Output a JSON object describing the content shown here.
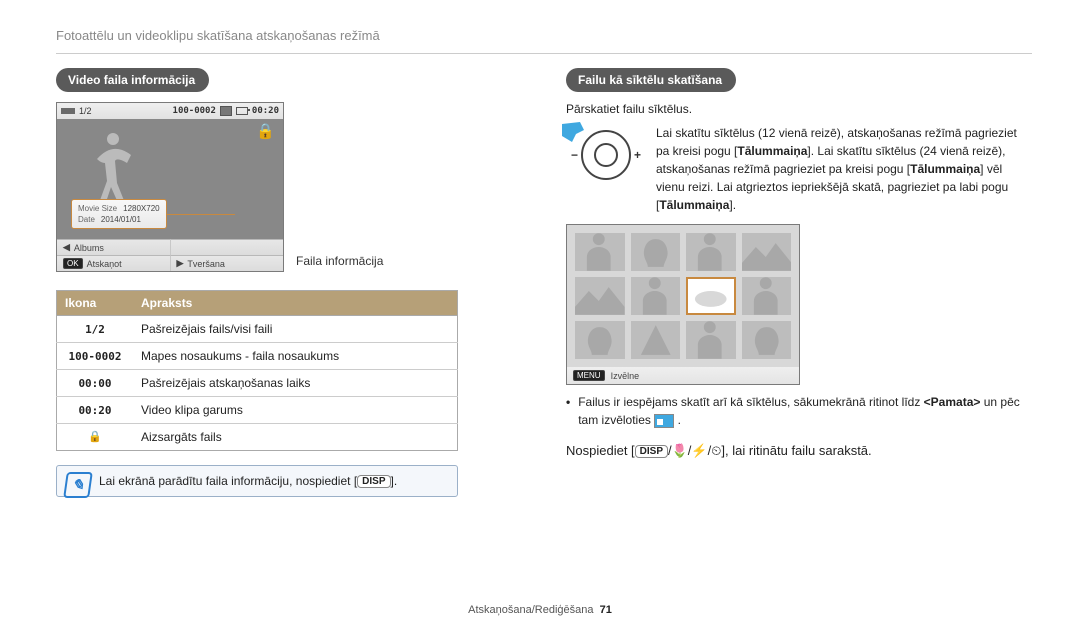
{
  "breadcrumb": "Fotoattēlu un videoklipu skatīšana atskaņošanas režīmā",
  "left": {
    "heading": "Video faila informācija",
    "camera": {
      "top_left_counter": "1/2",
      "top_folder": "100-0002",
      "top_time": "00:20",
      "lock_tooltip": "Aizsargāts",
      "popup_movie_size_k": "Movie Size",
      "popup_movie_size_v": "1280X720",
      "popup_date_k": "Date",
      "popup_date_v": "2014/01/01",
      "albums_arrow": "◀",
      "albums_label": "Albums",
      "ok_box": "OK",
      "ok_label": "Atskaņot",
      "capture_arrow": "▶",
      "capture_label": "Tveršana"
    },
    "callout": "Faila informācija",
    "table": {
      "h1": "Ikona",
      "h2": "Apraksts",
      "rows": [
        {
          "icon": "1/2",
          "desc": "Pašreizējais fails/visi faili"
        },
        {
          "icon": "100-0002",
          "desc": "Mapes nosaukums - faila nosaukums"
        },
        {
          "icon": "00:00",
          "desc": "Pašreizējais atskaņošanas laiks"
        },
        {
          "icon": "00:20",
          "desc": "Video klipa garums"
        },
        {
          "icon": "lock",
          "desc": "Aizsargāts fails"
        }
      ]
    },
    "note_pre": "Lai ekrānā parādītu faila informāciju, nospiediet [",
    "note_btn": "DISP",
    "note_post": "]."
  },
  "right": {
    "heading": "Failu kā sīktēlu skatīšana",
    "subtext": "Pārskatiet failu sīktēlus.",
    "zoom_text_pre": "Lai skatītu sīktēlus (12 vienā reizē), atskaņošanas režīmā pagrieziet pa kreisi pogu [",
    "zoom_b1": "Tālummaiņa",
    "zoom_mid": "]. Lai skatītu sīktēlus (24 vienā reizē), atskaņošanas režīmā pagrieziet pa kreisi pogu [",
    "zoom_b2": "Tālummaiņa",
    "zoom_mid2": "] vēl vienu reizi. Lai atgrieztos iepriekšējā skatā, pagrieziet pa labi pogu [",
    "zoom_b3": "Tālummaiņa",
    "zoom_end": "].",
    "thumb_bottom_menu": "MENU",
    "thumb_bottom_label": "Izvēlne",
    "bullet_pre": "Failus ir iespējams skatīt arī kā sīktēlus, sākumekrānā ritinot līdz ",
    "bullet_bold": "<Pamata>",
    "bullet_mid": " un pēc tam izvēloties ",
    "bullet_post": " .",
    "scroll_pre": "Nospiediet [",
    "scroll_disp": "DISP",
    "scroll_post": "], lai ritinātu failu sarakstā.",
    "scroll_icons": "/🌷/⚡/⏲"
  },
  "footer": {
    "section": "Atskaņošana/Rediģēšana",
    "page": "71"
  }
}
